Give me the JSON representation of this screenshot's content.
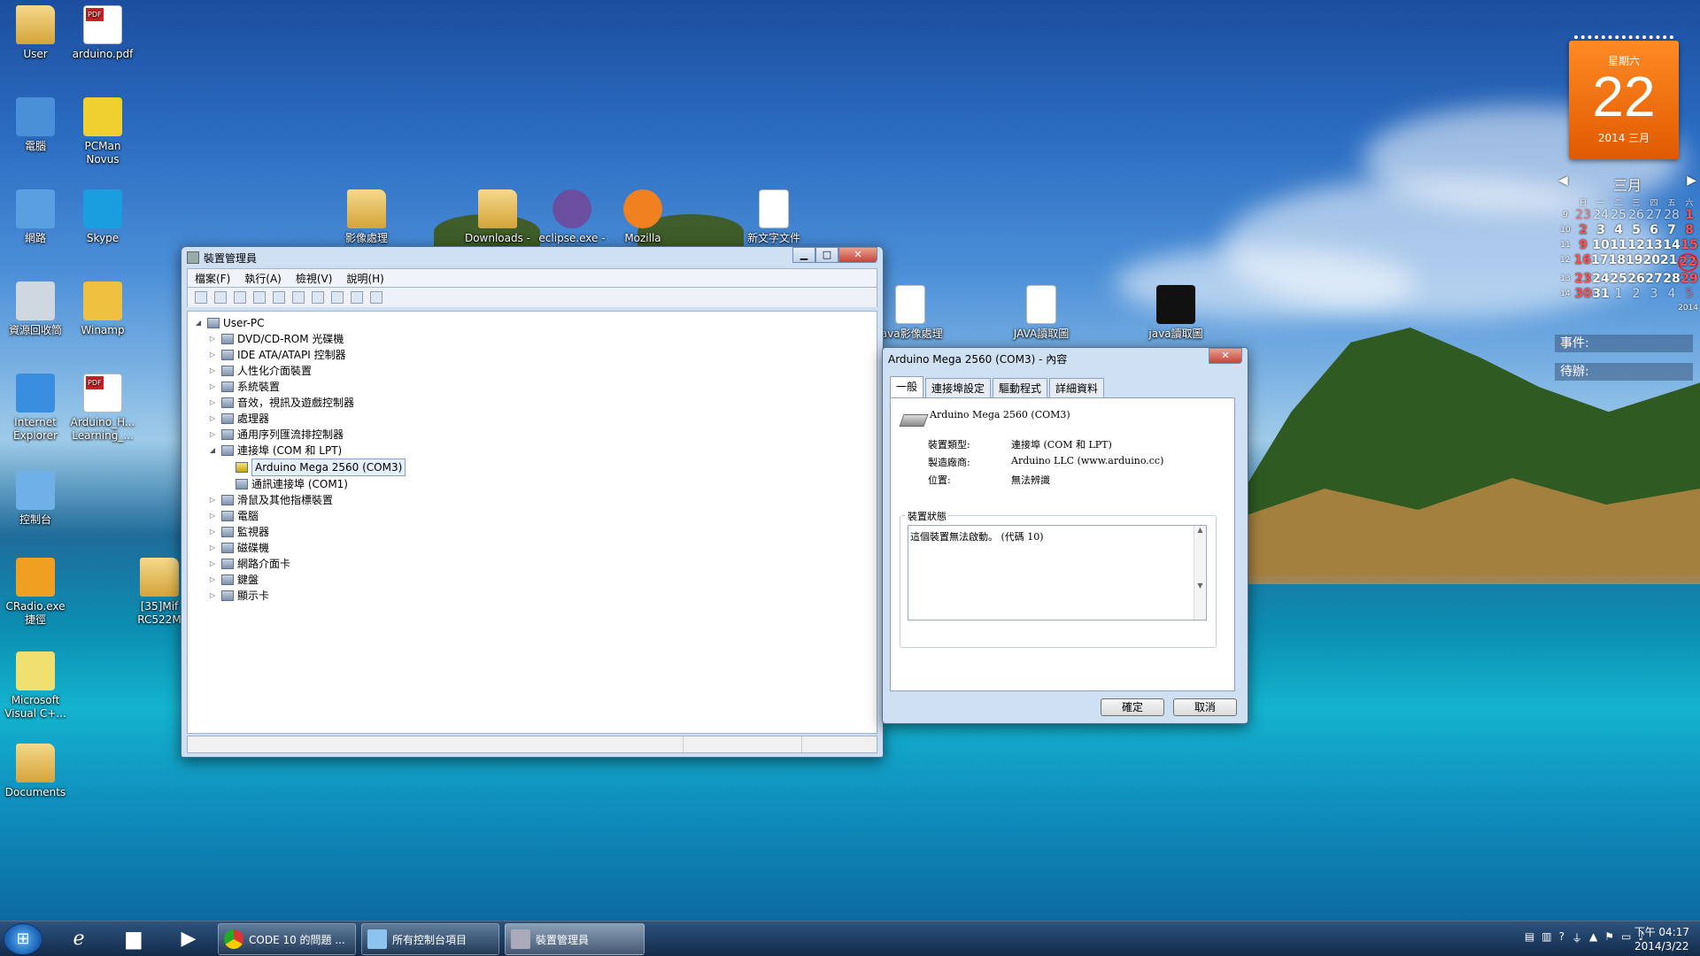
{
  "desktop": {
    "icons_left": [
      {
        "label": "User"
      },
      {
        "label": "arduino.pdf"
      },
      {
        "label": "電腦"
      },
      {
        "label": "PCMan Novus"
      },
      {
        "label": "網路"
      },
      {
        "label": "Skype"
      },
      {
        "label": "資源回收筒"
      },
      {
        "label": "Winamp"
      },
      {
        "label": "Internet Explorer"
      },
      {
        "label": "Arduino_H... Learning_..."
      },
      {
        "label": "控制台"
      },
      {
        "label": "CRadio.exe 捷徑"
      },
      {
        "label": "[35]Mif RC522M"
      },
      {
        "label": "Microsoft Visual C+..."
      },
      {
        "label": "Documents"
      }
    ],
    "icons_top": [
      {
        "label": "影像處理"
      },
      {
        "label": "Downloads - 捷徑"
      },
      {
        "label": "eclipse.exe - 捷徑"
      },
      {
        "label": "Mozilla Firefox"
      },
      {
        "label": "新文字文件"
      }
    ],
    "icons_mid": [
      {
        "label": "java影像處理"
      },
      {
        "label": "JAVA讀取圖"
      },
      {
        "label": "java讀取圖"
      }
    ]
  },
  "gadget": {
    "weekday": "星期六",
    "day": "22",
    "year_month": "2014 三月",
    "month_title": "三月",
    "weekday_headers": [
      "",
      "日",
      "一",
      "二",
      "三",
      "四",
      "五",
      "六"
    ],
    "weeks": [
      [
        "9",
        "23",
        "24",
        "25",
        "26",
        "27",
        "28",
        "1"
      ],
      [
        "10",
        "2",
        "3",
        "4",
        "5",
        "6",
        "7",
        "8"
      ],
      [
        "11",
        "9",
        "10",
        "11",
        "12",
        "13",
        "14",
        "15"
      ],
      [
        "12",
        "16",
        "17",
        "18",
        "19",
        "20",
        "21",
        "22"
      ],
      [
        "13",
        "23",
        "24",
        "25",
        "26",
        "27",
        "28",
        "29"
      ],
      [
        "14",
        "30",
        "31",
        "1",
        "2",
        "3",
        "4",
        "5"
      ]
    ],
    "year_small": "2014",
    "events_label": "事件:",
    "todo_label": "待辦:",
    "accent": "#f07010"
  },
  "devmgr": {
    "title": "裝置管理員",
    "menus": [
      "檔案(F)",
      "執行(A)",
      "檢視(V)",
      "說明(H)"
    ],
    "tree": [
      {
        "level": 0,
        "exp": "◢",
        "label": "User-PC"
      },
      {
        "level": 1,
        "exp": "▷",
        "label": "DVD/CD-ROM 光碟機"
      },
      {
        "level": 1,
        "exp": "▷",
        "label": "IDE ATA/ATAPI 控制器"
      },
      {
        "level": 1,
        "exp": "▷",
        "label": "人性化介面裝置"
      },
      {
        "level": 1,
        "exp": "▷",
        "label": "系統裝置"
      },
      {
        "level": 1,
        "exp": "▷",
        "label": "音效，視訊及遊戲控制器"
      },
      {
        "level": 1,
        "exp": "▷",
        "label": "處理器"
      },
      {
        "level": 1,
        "exp": "▷",
        "label": "通用序列匯流排控制器"
      },
      {
        "level": 1,
        "exp": "◢",
        "label": "連接埠 (COM 和 LPT)"
      },
      {
        "level": 2,
        "exp": "",
        "label": "Arduino Mega 2560 (COM3)",
        "selected": true
      },
      {
        "level": 2,
        "exp": "",
        "label": "通訊連接埠 (COM1)"
      },
      {
        "level": 1,
        "exp": "▷",
        "label": "滑鼠及其他指標裝置"
      },
      {
        "level": 1,
        "exp": "▷",
        "label": "電腦"
      },
      {
        "level": 1,
        "exp": "▷",
        "label": "監視器"
      },
      {
        "level": 1,
        "exp": "▷",
        "label": "磁碟機"
      },
      {
        "level": 1,
        "exp": "▷",
        "label": "網路介面卡"
      },
      {
        "level": 1,
        "exp": "▷",
        "label": "鍵盤"
      },
      {
        "level": 1,
        "exp": "▷",
        "label": "顯示卡"
      }
    ]
  },
  "props": {
    "title": "Arduino Mega 2560 (COM3) - 內容",
    "tabs": [
      "一般",
      "連接埠設定",
      "驅動程式",
      "詳細資料"
    ],
    "device_name": "Arduino Mega 2560 (COM3)",
    "type_label": "裝置類型:",
    "type_value": "連接埠 (COM 和 LPT)",
    "mfr_label": "製造廠商:",
    "mfr_value": "Arduino LLC (www.arduino.cc)",
    "loc_label": "位置:",
    "loc_value": "無法辨識",
    "status_legend": "裝置狀態",
    "status_text": "這個裝置無法啟動。 (代碼 10)",
    "ok": "確定",
    "cancel": "取消"
  },
  "taskbar": {
    "buttons": [
      {
        "label": "CODE 10 的問題 ..."
      },
      {
        "label": "所有控制台項目"
      },
      {
        "label": "裝置管理員"
      }
    ],
    "time": "下午 04:17",
    "date": "2014/3/22"
  }
}
